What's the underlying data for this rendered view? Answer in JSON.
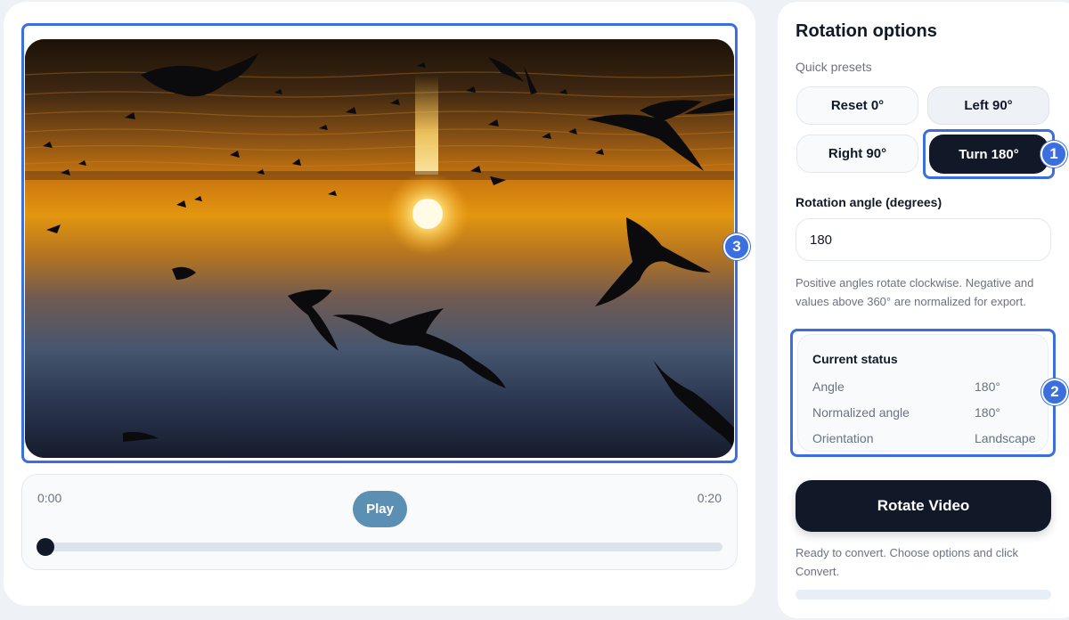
{
  "player": {
    "time_current": "0:00",
    "time_total": "0:20",
    "play_label": "Play",
    "scrub_position": 0
  },
  "markers": {
    "turn_preset": "1",
    "status_box": "2",
    "video_frame": "3"
  },
  "panel": {
    "title": "Rotation options",
    "presets_label": "Quick presets",
    "presets": {
      "reset": "Reset 0°",
      "left": "Left 90°",
      "right": "Right 90°",
      "turn": "Turn 180°"
    },
    "angle_label": "Rotation angle (degrees)",
    "angle_value": "180",
    "hint": "Positive angles rotate clockwise. Negative and values above 360° are normalized for export.",
    "status": {
      "title": "Current status",
      "rows": [
        {
          "key": "Angle",
          "value": "180°"
        },
        {
          "key": "Normalized angle",
          "value": "180°"
        },
        {
          "key": "Orientation",
          "value": "Landscape"
        }
      ]
    },
    "rotate_label": "Rotate Video",
    "ready_message": "Ready to convert. Choose options and click Convert.",
    "progress": 0
  },
  "colors": {
    "accent": "#3b6fe0",
    "dark": "#111827",
    "play": "#5b8fb3"
  }
}
